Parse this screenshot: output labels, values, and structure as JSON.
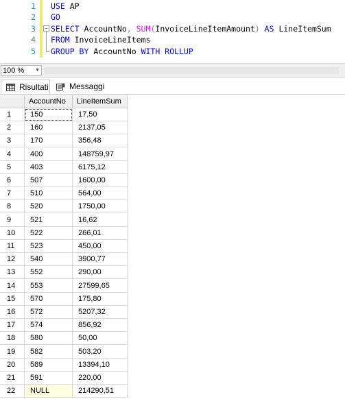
{
  "editor": {
    "lines": [
      {
        "n": "1",
        "tokens": [
          {
            "t": "USE",
            "c": "kw"
          },
          {
            "t": " AP",
            "c": "tx"
          }
        ]
      },
      {
        "n": "2",
        "tokens": [
          {
            "t": "GO",
            "c": "kw"
          }
        ]
      },
      {
        "n": "3",
        "tokens": [
          {
            "t": "SELECT",
            "c": "kw"
          },
          {
            "t": " AccountNo",
            "c": "tx"
          },
          {
            "t": ",",
            "c": "gr"
          },
          {
            "t": " ",
            "c": "tx"
          },
          {
            "t": "SUM",
            "c": "fn"
          },
          {
            "t": "(",
            "c": "gr"
          },
          {
            "t": "InvoiceLineItemAmount",
            "c": "tx"
          },
          {
            "t": ")",
            "c": "gr"
          },
          {
            "t": " ",
            "c": "tx"
          },
          {
            "t": "AS",
            "c": "kw"
          },
          {
            "t": " LineItemSum",
            "c": "tx"
          }
        ]
      },
      {
        "n": "4",
        "tokens": [
          {
            "t": "FROM",
            "c": "kw"
          },
          {
            "t": " InvoiceLineItems",
            "c": "tx"
          }
        ]
      },
      {
        "n": "5",
        "tokens": [
          {
            "t": "GROUP BY",
            "c": "kw"
          },
          {
            "t": " AccountNo ",
            "c": "tx"
          },
          {
            "t": "WITH ROLLUP",
            "c": "kw"
          }
        ]
      }
    ],
    "fold_symbol": "−"
  },
  "zoom": {
    "value": "100 %",
    "arrow": "▼"
  },
  "tabs": [
    {
      "label": "Risultati",
      "icon": "results-grid-icon",
      "active": true
    },
    {
      "label": "Messaggi",
      "icon": "messages-icon",
      "active": false
    }
  ],
  "grid": {
    "columns": [
      "AccountNo",
      "LineItemSum"
    ],
    "rows": [
      {
        "n": "1",
        "acc": "150",
        "sum": "17,50"
      },
      {
        "n": "2",
        "acc": "160",
        "sum": "2137,05"
      },
      {
        "n": "3",
        "acc": "170",
        "sum": "356,48"
      },
      {
        "n": "4",
        "acc": "400",
        "sum": "148759,97"
      },
      {
        "n": "5",
        "acc": "403",
        "sum": "6175,12"
      },
      {
        "n": "6",
        "acc": "507",
        "sum": "1600,00"
      },
      {
        "n": "7",
        "acc": "510",
        "sum": "564,00"
      },
      {
        "n": "8",
        "acc": "520",
        "sum": "1750,00"
      },
      {
        "n": "9",
        "acc": "521",
        "sum": "16,62"
      },
      {
        "n": "10",
        "acc": "522",
        "sum": "266,01"
      },
      {
        "n": "11",
        "acc": "523",
        "sum": "450,00"
      },
      {
        "n": "12",
        "acc": "540",
        "sum": "3900,77"
      },
      {
        "n": "13",
        "acc": "552",
        "sum": "290,00"
      },
      {
        "n": "14",
        "acc": "553",
        "sum": "27599,65"
      },
      {
        "n": "15",
        "acc": "570",
        "sum": "175,80"
      },
      {
        "n": "16",
        "acc": "572",
        "sum": "5207,32"
      },
      {
        "n": "17",
        "acc": "574",
        "sum": "856,92"
      },
      {
        "n": "18",
        "acc": "580",
        "sum": "50,00"
      },
      {
        "n": "19",
        "acc": "582",
        "sum": "503,20"
      },
      {
        "n": "20",
        "acc": "589",
        "sum": "13394,10"
      },
      {
        "n": "21",
        "acc": "591",
        "sum": "220,00"
      },
      {
        "n": "22",
        "acc": "NULL",
        "sum": "214290,51"
      }
    ]
  }
}
